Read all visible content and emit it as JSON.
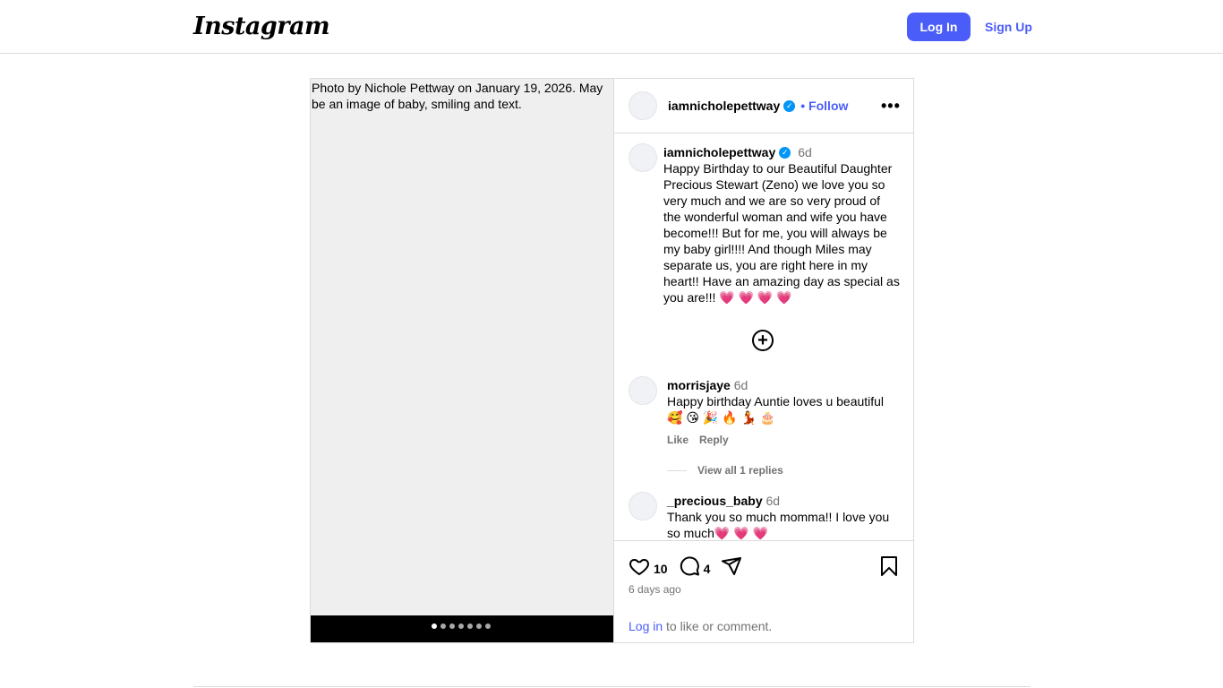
{
  "header": {
    "logo_text": "Instagram",
    "login_label": "Log In",
    "signup_label": "Sign Up",
    "accent_color": "#4a5df9"
  },
  "media": {
    "alt_text": "Photo by Nichole Pettway on January 19, 2026. May be an image of baby, smiling and text.",
    "carousel_count": 7
  },
  "post_header": {
    "username": "iamnicholepettway",
    "verified": true,
    "follow_label": "• Follow",
    "more_icon": "more-horizontal-icon"
  },
  "caption": {
    "username": "iamnicholepettway",
    "time": "6d",
    "text": "Happy Birthday to our Beautiful Daughter Precious Stewart (Zeno) we love you so very much and we are so very proud of the wonderful woman and wife you have become!!! But for me, you will always be my baby girl!!!! And though Miles may separate us, you are right here in my heart!! Have an amazing day as special as you are!!! 💗 💗 💗 💗"
  },
  "load_more_icon": "plus-circle-icon",
  "comments": [
    {
      "username": "morrisjaye",
      "time": "6d",
      "text": "Happy birthday Auntie loves u beautiful 🥰 😘 🎉 🔥 💃 🎂",
      "like_label": "Like",
      "reply_label": "Reply",
      "replies_label": "View all 1 replies"
    },
    {
      "username": "_precious_baby",
      "time": "6d",
      "text": "Thank you so much momma!! I love you so much💗 💗 💗"
    }
  ],
  "actions": {
    "like_count": "10",
    "comment_count": "4",
    "posted_ago": "6 days ago",
    "login_link": "Log in",
    "login_suffix": " to like or comment."
  }
}
